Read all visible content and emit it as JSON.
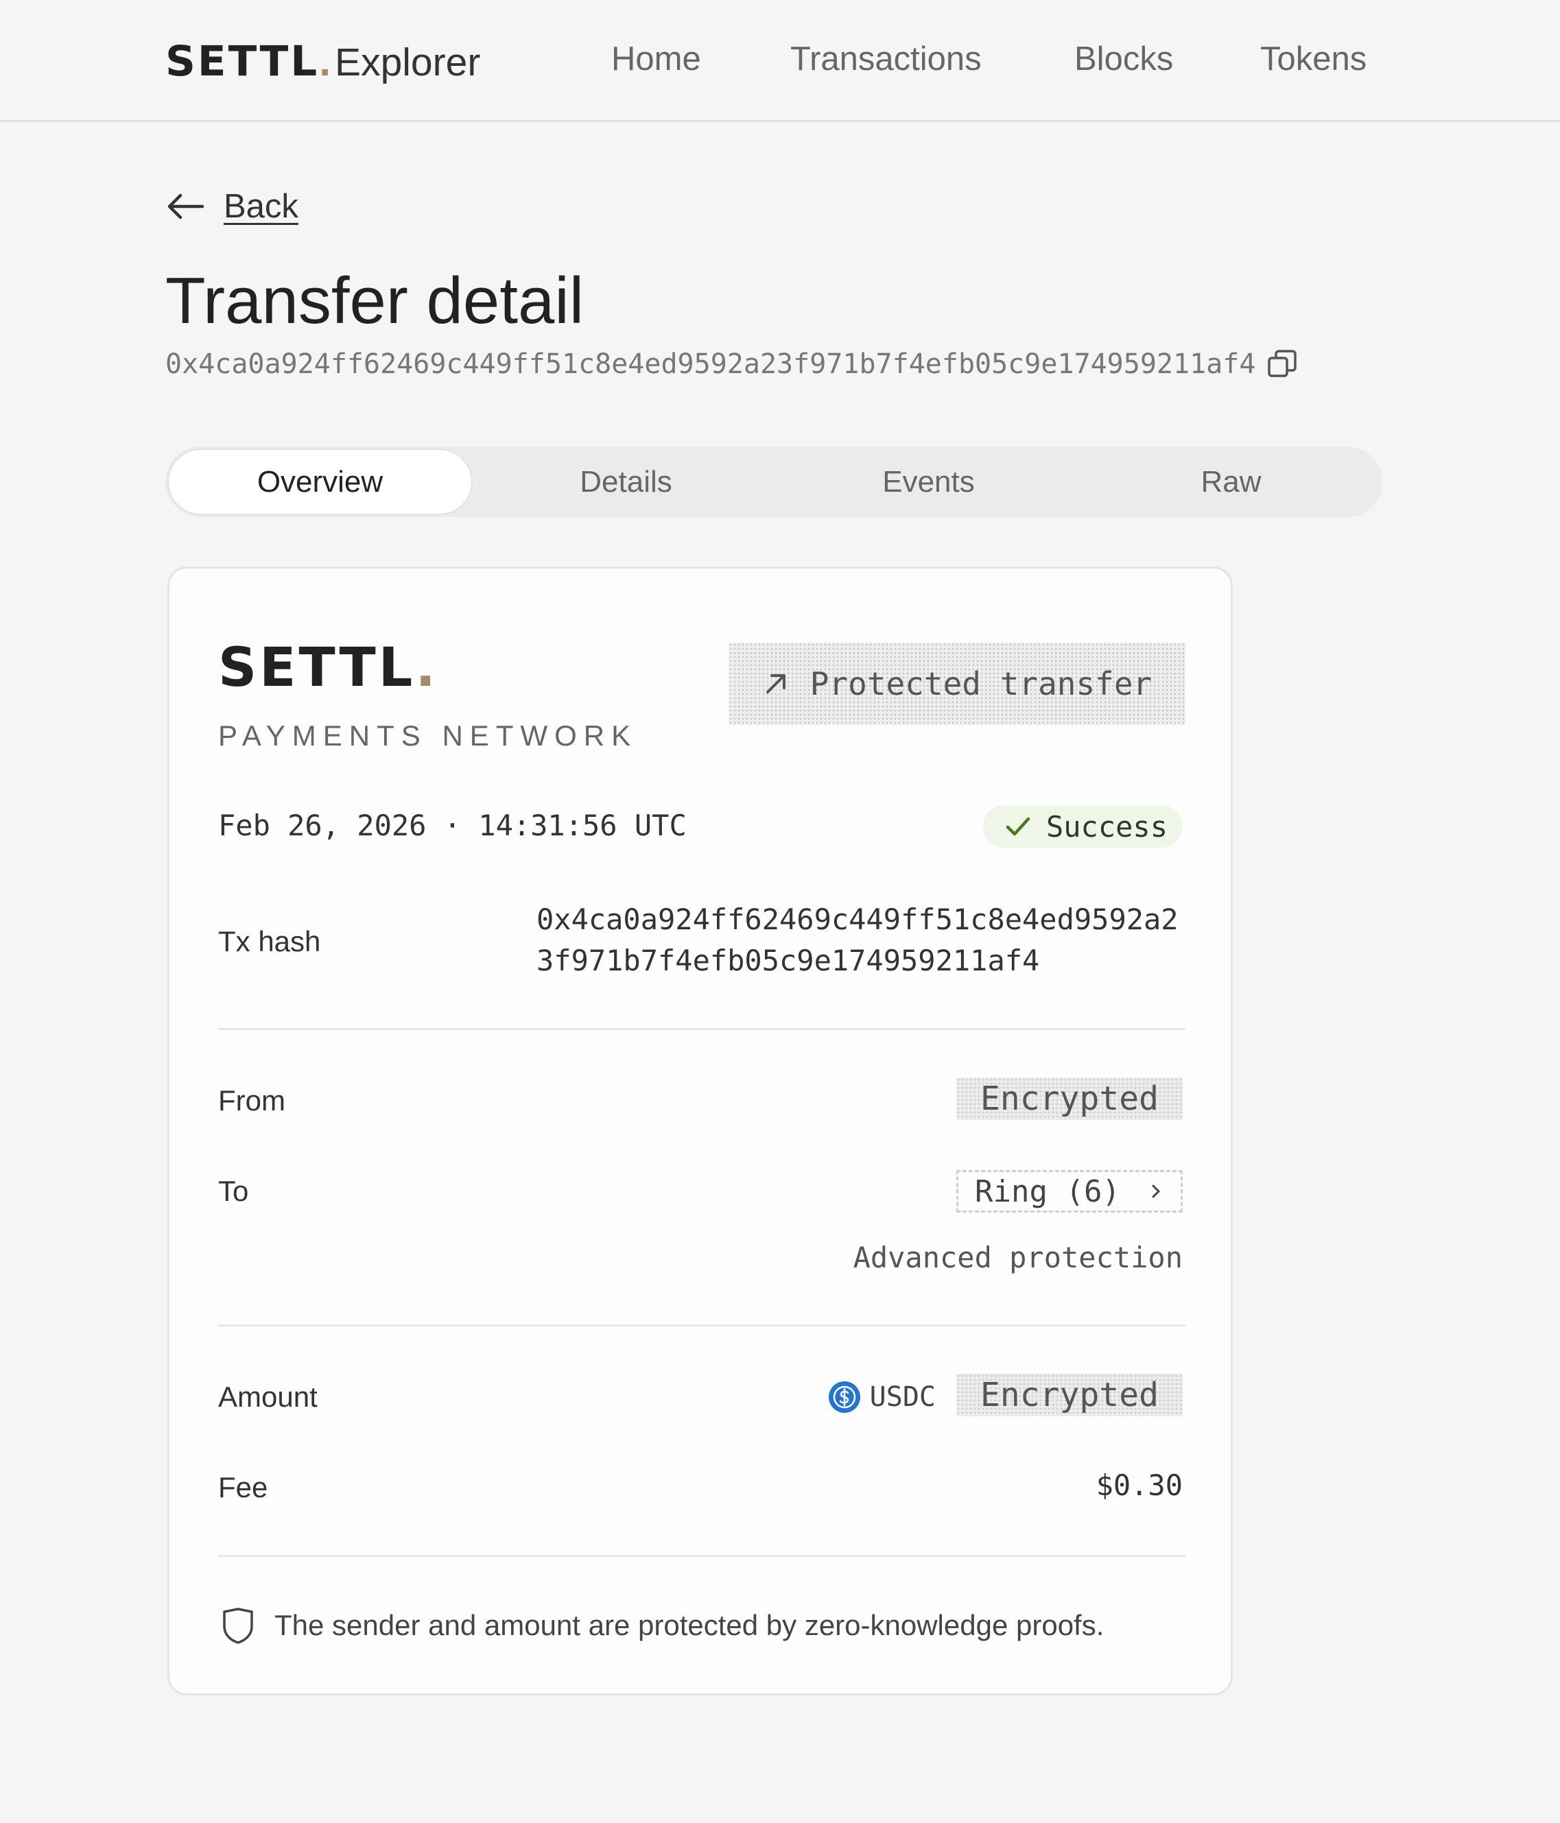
{
  "header": {
    "brand": "SETTL",
    "brand_dot": ".",
    "brand_sub": "Explorer",
    "nav": [
      {
        "label": "Home"
      },
      {
        "label": "Transactions"
      },
      {
        "label": "Blocks"
      },
      {
        "label": "Tokens"
      }
    ]
  },
  "back": {
    "label": "Back",
    "icon": "arrow-left-icon"
  },
  "page": {
    "title": "Transfer detail",
    "hash": "0x4ca0a924ff62469c449ff51c8e4ed9592a23f971b7f4efb05c9e174959211af4",
    "copy_icon": "copy-icon"
  },
  "tabs": [
    {
      "label": "Overview",
      "active": true
    },
    {
      "label": "Details",
      "active": false
    },
    {
      "label": "Events",
      "active": false
    },
    {
      "label": "Raw",
      "active": false
    }
  ],
  "card": {
    "logo": "SETTL",
    "logo_dot": ".",
    "tagline": "PAYMENTS NETWORK",
    "badge": {
      "label": "Protected transfer",
      "icon": "arrow-up-right-icon"
    },
    "datetime": "Feb 26, 2026 · 14:31:56 UTC",
    "status": {
      "label": "Success",
      "icon": "check-icon",
      "color": "#4a7a1c"
    },
    "tx_hash_label": "Tx hash",
    "tx_hash": "0x4ca0a924ff62469c449ff51c8e4ed9592a23f971b7f4efb05c9e174959211af4",
    "from_label": "From",
    "from_value": "Encrypted",
    "to_label": "To",
    "to_value": "Ring (6)",
    "to_note": "Advanced protection",
    "amount_label": "Amount",
    "amount_token": "USDC",
    "amount_token_color": "#2775ca",
    "amount_value": "Encrypted",
    "fee_label": "Fee",
    "fee_value": "$0.30",
    "footnote": "The sender and amount are protected by zero-knowledge proofs.",
    "footnote_icon": "shield-icon"
  },
  "colors": {
    "accent": "#a68b67",
    "background": "#f5f5f5",
    "card": "#fdfdfd"
  }
}
